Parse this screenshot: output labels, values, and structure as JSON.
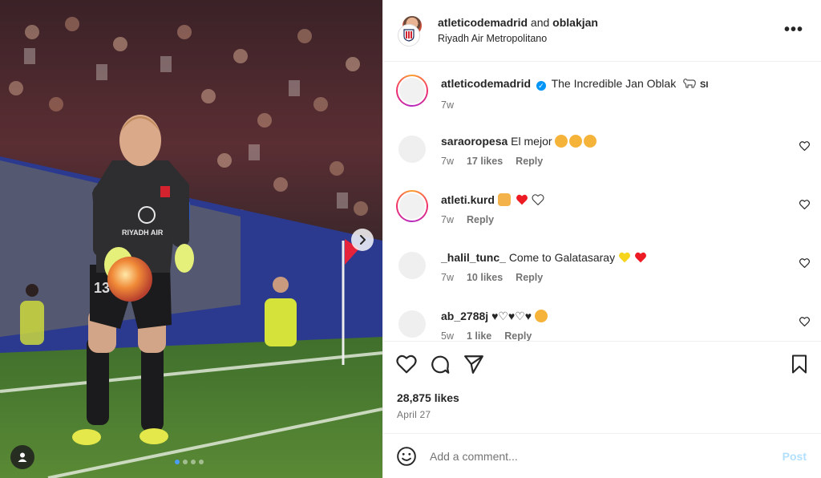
{
  "post": {
    "header": {
      "author": "atleticodemadrid",
      "joiner": "and",
      "coauthor": "oblakjan",
      "location": "Riyadh Air Metropolitano",
      "more_icon": "ellipsis-icon"
    },
    "photo": {
      "jersey_sponsor": "RIYADH AIR",
      "jersey_number": "13",
      "carousel_dots": 4,
      "carousel_active": 0
    },
    "caption": {
      "user": "atleticodemadrid",
      "verified": true,
      "text": "The Incredible Jan Oblak",
      "suffix": "SI",
      "time": "7w"
    },
    "comments": [
      {
        "user": "saraoropesa",
        "text": "El mejor",
        "time": "7w",
        "likes": "17 likes",
        "reply": "Reply"
      },
      {
        "user": "atleti.kurd",
        "text": "",
        "time": "7w",
        "likes": "",
        "reply": "Reply"
      },
      {
        "user": "_halil_tunc_",
        "text": "Come to Galatasaray",
        "time": "7w",
        "likes": "10 likes",
        "reply": "Reply"
      },
      {
        "user": "ab_2788j",
        "text": "",
        "time": "5w",
        "likes": "1 like",
        "reply": "Reply"
      }
    ],
    "likes": "28,875 likes",
    "date": "April 27",
    "add_comment": {
      "placeholder": "Add a comment...",
      "post_label": "Post"
    },
    "colors": {
      "accent": "#0095f6",
      "post_disabled": "#b2dffc",
      "heart_red": "#ed1c24",
      "text_muted": "#737373"
    }
  }
}
